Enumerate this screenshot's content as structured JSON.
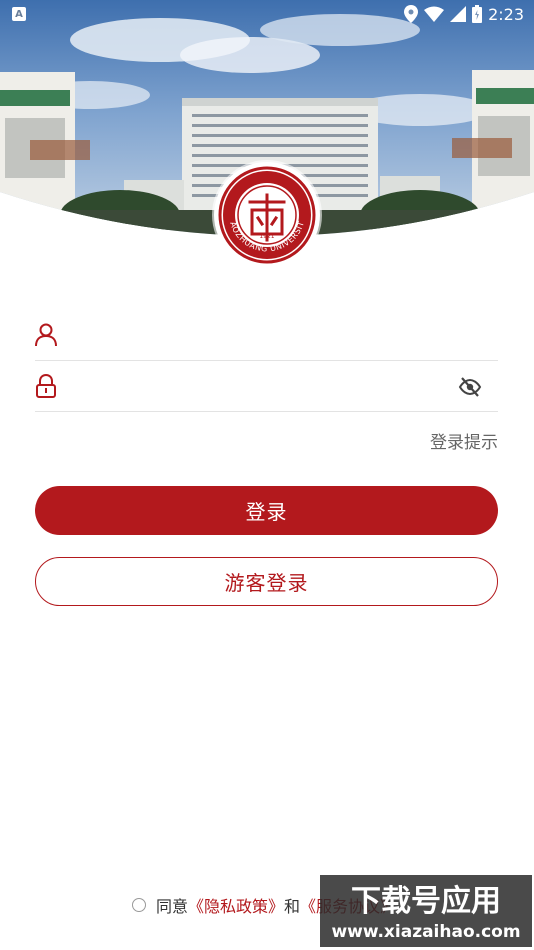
{
  "status_bar": {
    "time": "2:23",
    "app_icon_letter": "A",
    "icons": [
      "location-icon",
      "wifi-icon",
      "signal-icon",
      "battery-icon"
    ]
  },
  "logo": {
    "name": "university-seal",
    "text_arc": "ZAOZHUANG UNIVERSITY",
    "year": "1921"
  },
  "form": {
    "username": {
      "value": "",
      "placeholder": "",
      "icon": "user-icon"
    },
    "password": {
      "value": "",
      "placeholder": "",
      "icon": "lock-icon",
      "toggle_icon": "eye-off-icon"
    },
    "hint_label": "登录提示"
  },
  "buttons": {
    "login_label": "登录",
    "guest_label": "游客登录"
  },
  "agreement": {
    "prefix": "同意",
    "privacy_link": "《隐私政策》",
    "and": "和",
    "terms_link": "《服务协议》"
  },
  "watermark": {
    "title": "下载号应用",
    "url": "www.xiazaihao.com"
  },
  "colors": {
    "accent": "#b3191d",
    "divider": "#e3e3e3",
    "hint": "#666666"
  }
}
